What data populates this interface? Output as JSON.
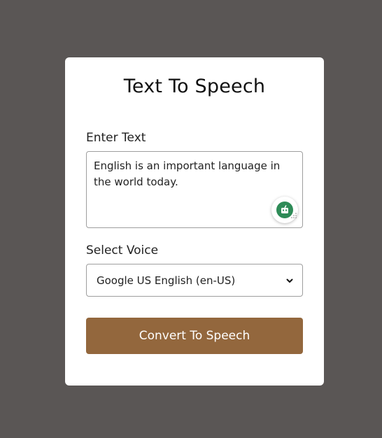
{
  "title": "Text To Speech",
  "text_input": {
    "label": "Enter Text",
    "value": "English is an important language in the world today."
  },
  "voice_select": {
    "label": "Select Voice",
    "selected": "Google US English (en-US)"
  },
  "convert_button": {
    "label": "Convert To Speech"
  },
  "icons": {
    "grammar_assistant": "grammar-assistant-icon",
    "dropdown": "chevron-down-icon",
    "resize": "resize-grip-icon"
  },
  "colors": {
    "background": "#5a5655",
    "card": "#ffffff",
    "button": "#93673d",
    "assistant_badge": "#2e8b57"
  }
}
